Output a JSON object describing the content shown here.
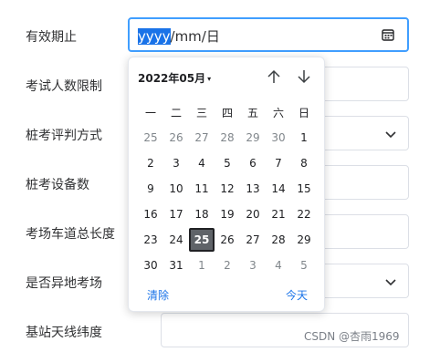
{
  "form": {
    "rows": [
      {
        "label": "有效期止"
      },
      {
        "label": "考试人数限制"
      },
      {
        "label": "桩考评判方式"
      },
      {
        "label": "桩考设备数"
      },
      {
        "label": "考场车道总长度"
      },
      {
        "label": "是否异地考场"
      },
      {
        "label": "基站天线纬度"
      }
    ],
    "date_input": {
      "selected_part": "yyyy",
      "rest": "/mm/日"
    }
  },
  "calendar": {
    "month_label": "2022年05月",
    "caret": "▾",
    "weekdays": [
      "一",
      "二",
      "三",
      "四",
      "五",
      "六",
      "日"
    ],
    "weeks": [
      [
        "25",
        "26",
        "27",
        "28",
        "29",
        "30",
        "1"
      ],
      [
        "2",
        "3",
        "4",
        "5",
        "6",
        "7",
        "8"
      ],
      [
        "9",
        "10",
        "11",
        "12",
        "13",
        "14",
        "15"
      ],
      [
        "16",
        "17",
        "18",
        "19",
        "20",
        "21",
        "22"
      ],
      [
        "23",
        "24",
        "25",
        "26",
        "27",
        "28",
        "29"
      ],
      [
        "30",
        "31",
        "1",
        "2",
        "3",
        "4",
        "5"
      ]
    ],
    "clear_label": "清除",
    "today_label": "今天"
  },
  "watermark": "CSDN @杏雨1969",
  "colors": {
    "accent": "#1a73e8",
    "focus_border": "#409eff",
    "today_bg": "#5f6368"
  }
}
